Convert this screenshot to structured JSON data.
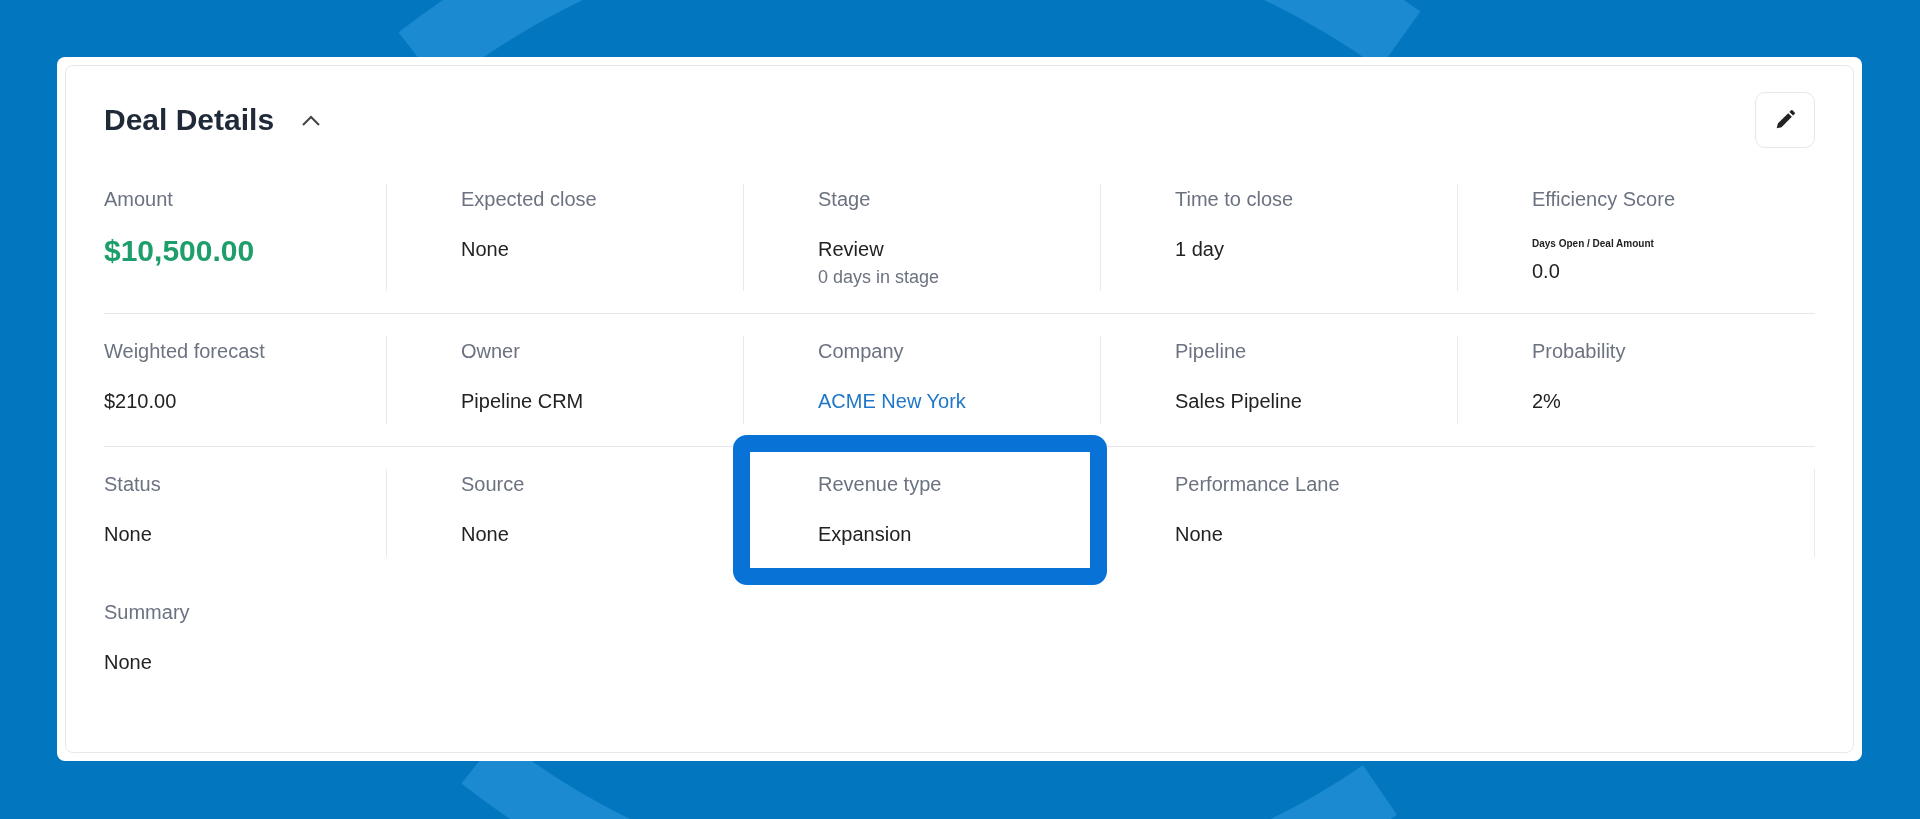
{
  "panel": {
    "title": "Deal Details",
    "expanded": true
  },
  "rows": [
    [
      {
        "label": "Amount",
        "value": "$10,500.00",
        "kind": "money"
      },
      {
        "label": "Expected close",
        "value": "None",
        "kind": "text"
      },
      {
        "label": "Stage",
        "value": "Review",
        "sub": "0 days in stage",
        "kind": "stacked"
      },
      {
        "label": "Time to close",
        "value": "1 day",
        "kind": "text"
      },
      {
        "label": "Efficiency Score",
        "note": "Days Open / Deal Amount",
        "value": "0.0",
        "kind": "noted"
      }
    ],
    [
      {
        "label": "Weighted forecast",
        "value": "$210.00",
        "kind": "text"
      },
      {
        "label": "Owner",
        "value": "Pipeline CRM",
        "kind": "text"
      },
      {
        "label": "Company",
        "value": "ACME New York",
        "kind": "link"
      },
      {
        "label": "Pipeline",
        "value": "Sales Pipeline",
        "kind": "text"
      },
      {
        "label": "Probability",
        "value": "2%",
        "kind": "text"
      }
    ],
    [
      {
        "label": "Status",
        "value": "None",
        "kind": "text"
      },
      {
        "label": "Source",
        "value": "None",
        "kind": "text"
      },
      {
        "label": "Revenue type",
        "value": "Expansion",
        "kind": "text",
        "highlighted": true
      },
      {
        "label": "Performance Lane",
        "value": "None",
        "kind": "text"
      }
    ]
  ],
  "summary": {
    "label": "Summary",
    "value": "None"
  }
}
